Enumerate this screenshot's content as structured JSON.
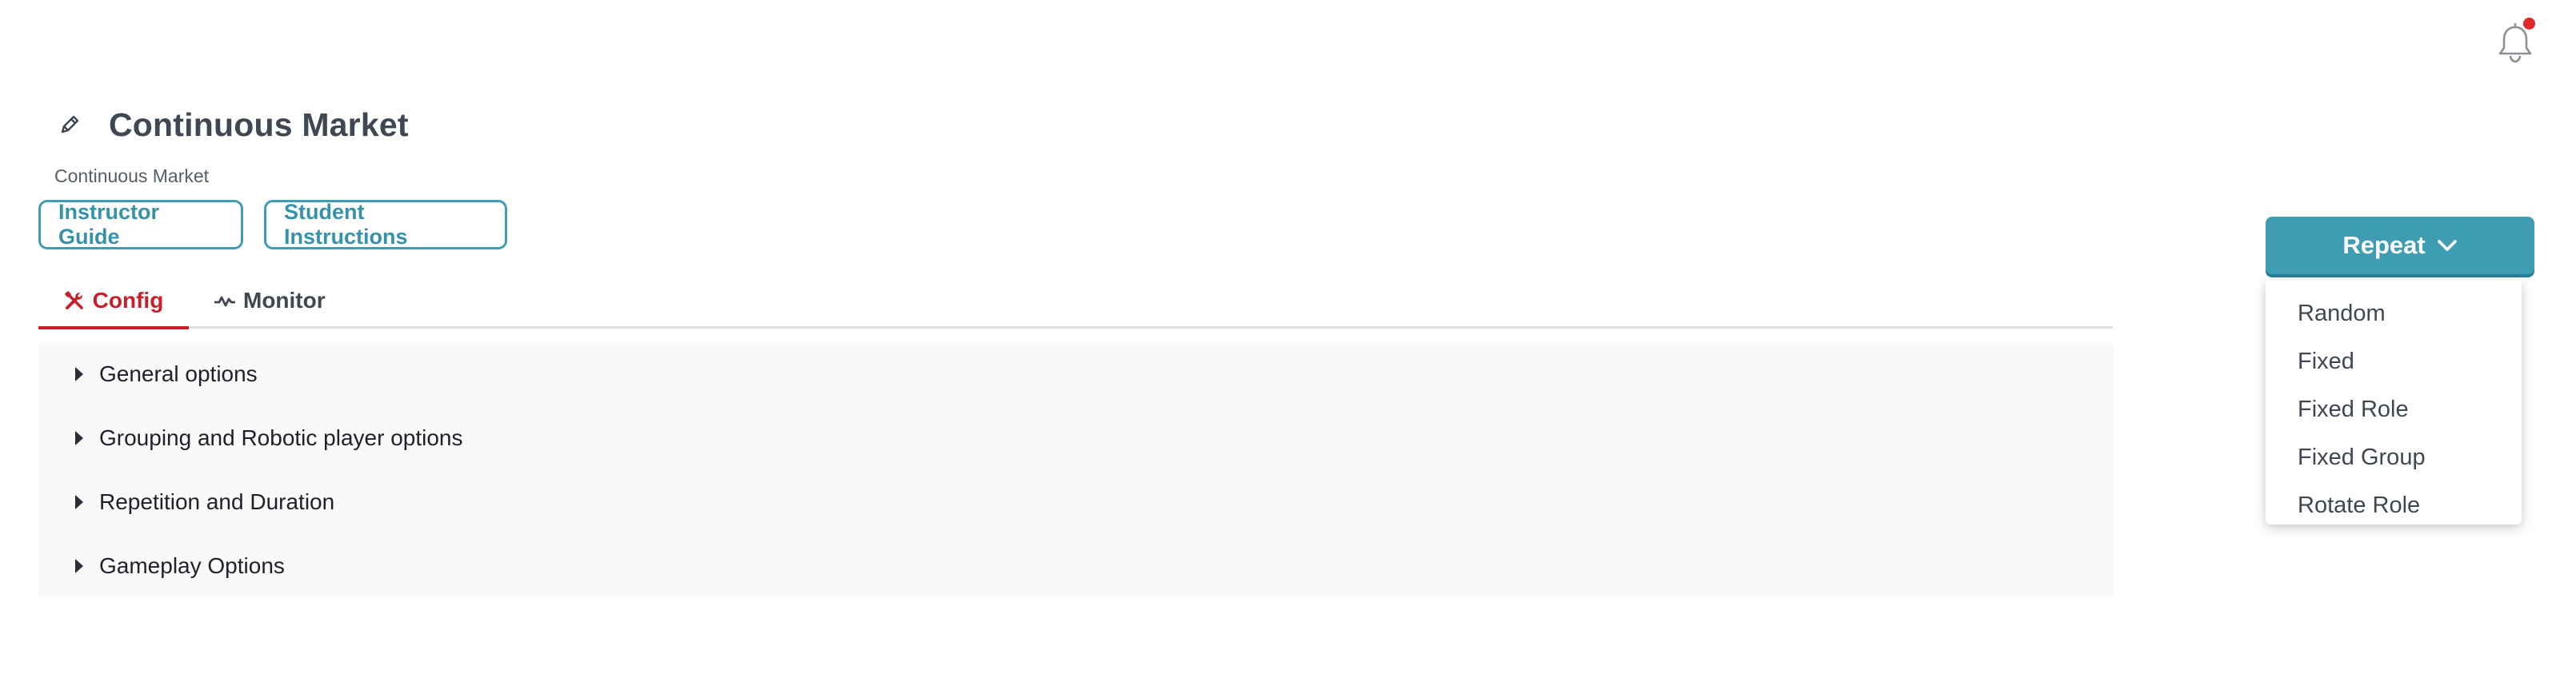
{
  "header": {
    "title": "Continuous Market",
    "subtitle": "Continuous Market",
    "notification_icon": "bell-icon",
    "notification_dot_color": "#e0282d",
    "edit_icon": "pencil-icon"
  },
  "guides": {
    "instructor_label": "Instructor Guide",
    "student_label": "Student Instructions"
  },
  "tabs": [
    {
      "label": "Config",
      "icon": "tools-icon",
      "active": true
    },
    {
      "label": "Monitor",
      "icon": "activity-icon",
      "active": false
    }
  ],
  "sections": [
    {
      "label": "General options"
    },
    {
      "label": "Grouping and Robotic player options"
    },
    {
      "label": "Repetition and Duration"
    },
    {
      "label": "Gameplay Options"
    }
  ],
  "repeat_dropdown": {
    "label": "Repeat",
    "options": [
      "Random",
      "Fixed",
      "Fixed Role",
      "Fixed Group",
      "Rotate Role"
    ]
  },
  "colors": {
    "accent": "#3f9db3",
    "active_tab": "#c8202b"
  }
}
